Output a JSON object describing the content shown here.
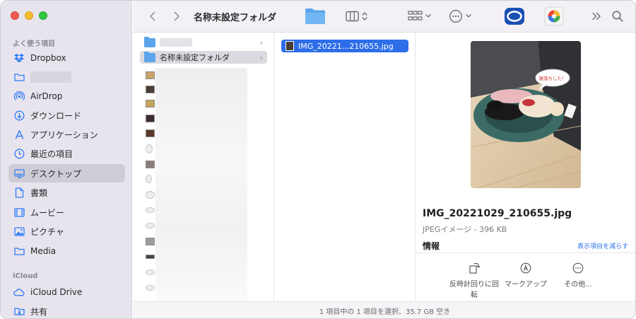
{
  "sidebar": {
    "favorites_header": "よく使う項目",
    "icloud_header": "iCloud",
    "items": [
      {
        "label": "Dropbox",
        "icon": "dropbox-icon"
      },
      {
        "label": "",
        "icon": "folder-icon"
      },
      {
        "label": "AirDrop",
        "icon": "airdrop-icon"
      },
      {
        "label": "ダウンロード",
        "icon": "download-icon"
      },
      {
        "label": "アプリケーション",
        "icon": "applications-icon"
      },
      {
        "label": "最近の項目",
        "icon": "clock-icon"
      },
      {
        "label": "デスクトップ",
        "icon": "desktop-icon",
        "selected": true
      },
      {
        "label": "書類",
        "icon": "document-icon"
      },
      {
        "label": "ムービー",
        "icon": "film-icon"
      },
      {
        "label": "ピクチャ",
        "icon": "photo-icon"
      },
      {
        "label": "Media",
        "icon": "folder-icon"
      }
    ],
    "icloud_items": [
      {
        "label": "iCloud Drive",
        "icon": "cloud-icon"
      },
      {
        "label": "共有",
        "icon": "shared-folder-icon"
      }
    ]
  },
  "toolbar": {
    "title": "名称未設定フォルダ"
  },
  "column1": {
    "selected_folder": "名称未設定フォルダ"
  },
  "column2": {
    "selected_file": "IMG_20221...210655.jpg"
  },
  "preview": {
    "speech_bubble": "寝落ちした！",
    "file_name": "IMG_20221029_210655.jpg",
    "file_meta": "JPEGイメージ - 396 KB",
    "info_header": "情報",
    "show_less_link": "表示項目を減らす",
    "actions": [
      {
        "label": "反時計回りに回転",
        "icon": "rotate-left-icon"
      },
      {
        "label": "マークアップ",
        "icon": "markup-icon"
      },
      {
        "label": "その他...",
        "icon": "more-icon"
      }
    ]
  },
  "status_bar": {
    "text": "1 項目中の 1 項目を選択、35.7 GB 空き"
  },
  "colors": {
    "accent": "#2d6ee8",
    "sidebar_bg": "#e8e4ee",
    "folder": "#5ba5ec"
  }
}
